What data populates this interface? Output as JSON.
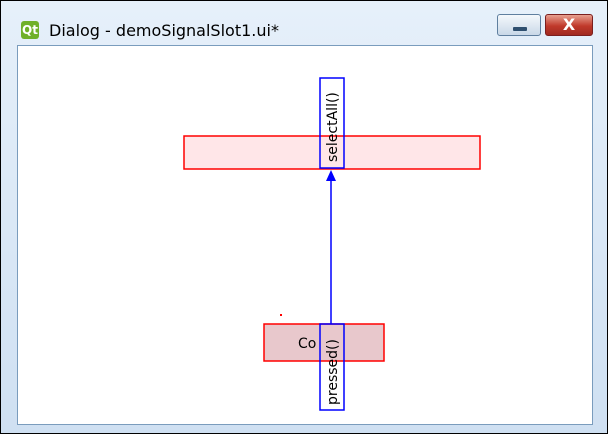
{
  "window": {
    "title": "Dialog - demoSignalSlot1.ui*",
    "app_icon": "qt-designer-icon",
    "close_glyph": "X"
  },
  "canvas": {
    "receiver_slot": "selectAll()",
    "sender_signal": "pressed()",
    "sender_button_text": "Co"
  },
  "colors": {
    "selection_red": "#ff0000",
    "connection_blue": "#0000ff",
    "receiver_fill": "#ffe6e8",
    "sender_fill": "#e8c8cc"
  }
}
